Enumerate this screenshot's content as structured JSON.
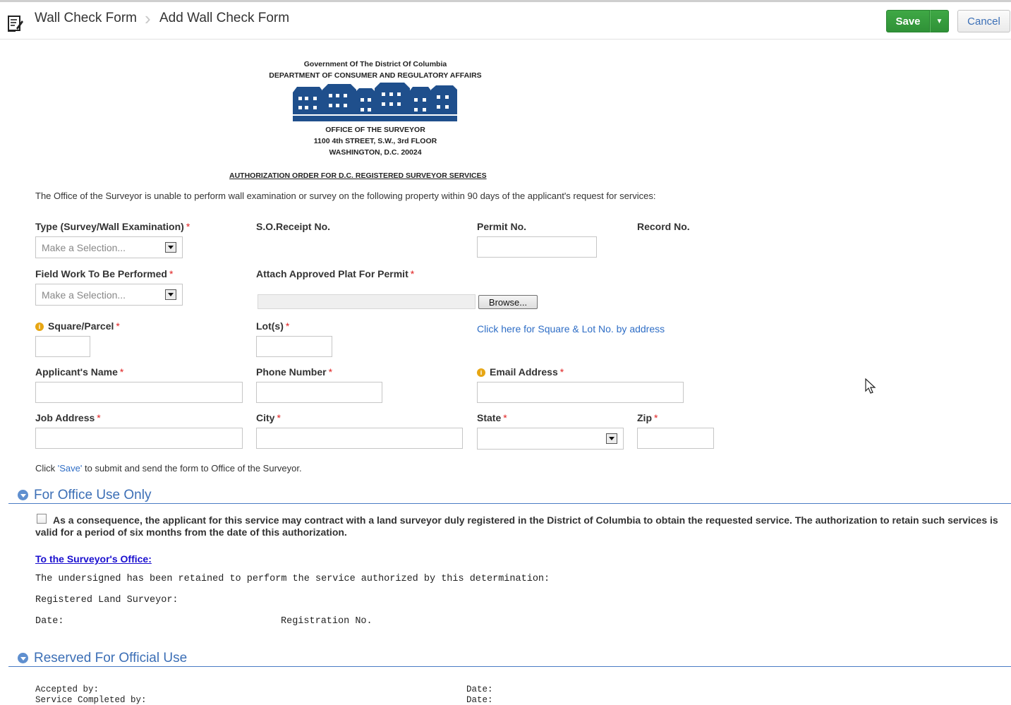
{
  "header": {
    "breadcrumb_root": "Wall Check Form",
    "breadcrumb_current": "Add Wall Check Form",
    "save_label": "Save",
    "cancel_label": "Cancel"
  },
  "letterhead": {
    "line1": "Government Of The District Of Columbia",
    "line2": "DEPARTMENT OF CONSUMER AND REGULATORY AFFAIRS",
    "line3": "OFFICE OF THE SURVEYOR",
    "line4": "1100 4th STREET, S.W., 3rd FLOOR",
    "line5": "WASHINGTON, D.C. 20024",
    "order_title": "AUTHORIZATION ORDER FOR D.C. REGISTERED SURVEYOR SERVICES",
    "intro": "The Office of the Surveyor is unable to perform wall examination or survey on the following property within 90 days of the applicant's request for services:"
  },
  "form": {
    "type_label": "Type (Survey/Wall Examination)",
    "type_placeholder": "Make a Selection...",
    "receipt_label": "S.O.Receipt No.",
    "permit_label": "Permit No.",
    "permit_value": "",
    "record_label": "Record No.",
    "fieldwork_label": "Field Work To Be Performed",
    "fieldwork_placeholder": "Make a Selection...",
    "plat_label": "Attach Approved Plat For Permit",
    "browse_label": "Browse...",
    "square_label": "Square/Parcel",
    "square_value": "",
    "lots_label": "Lot(s)",
    "lots_value": "",
    "lookup_link": "Click here for Square & Lot No. by address",
    "name_label": "Applicant's Name",
    "name_value": "",
    "phone_label": "Phone Number",
    "phone_value": "",
    "email_label": "Email Address",
    "email_value": "",
    "address_label": "Job Address",
    "address_value": "",
    "city_label": "City",
    "city_value": "",
    "state_label": "State",
    "state_value": "",
    "zip_label": "Zip",
    "zip_value": "",
    "required_mark": "*",
    "info_mark": "i",
    "note_prefix": "Click ",
    "note_save": "'Save'",
    "note_suffix": " to submit and send the form to Office of the Surveyor."
  },
  "office_use": {
    "title": "For Office Use Only",
    "checkbox_text": "As a consequence, the applicant for this service may contract with a land surveyor duly registered in the District of Columbia to obtain the requested service. The authorization to retain such services is valid for a period of six months from the date of this authorization.",
    "surveyor_link": "To the Surveyor's Office:",
    "retained_text": "The undersigned has been retained to perform the service authorized by this determination:",
    "registered_text": "Registered Land Surveyor:",
    "date_text": "Date:",
    "registration_text": "Registration No."
  },
  "reserved": {
    "title": "Reserved For Official Use",
    "accepted_text": "Accepted by:",
    "completed_text": "Service Completed by:",
    "date1_text": "Date:",
    "date2_text": "Date:"
  },
  "colors": {
    "save_green": "#3fa845",
    "link_blue": "#2f6ec6",
    "section_blue": "#3c6fb6",
    "required_red": "#e02020",
    "building_navy": "#1f4f8c"
  }
}
